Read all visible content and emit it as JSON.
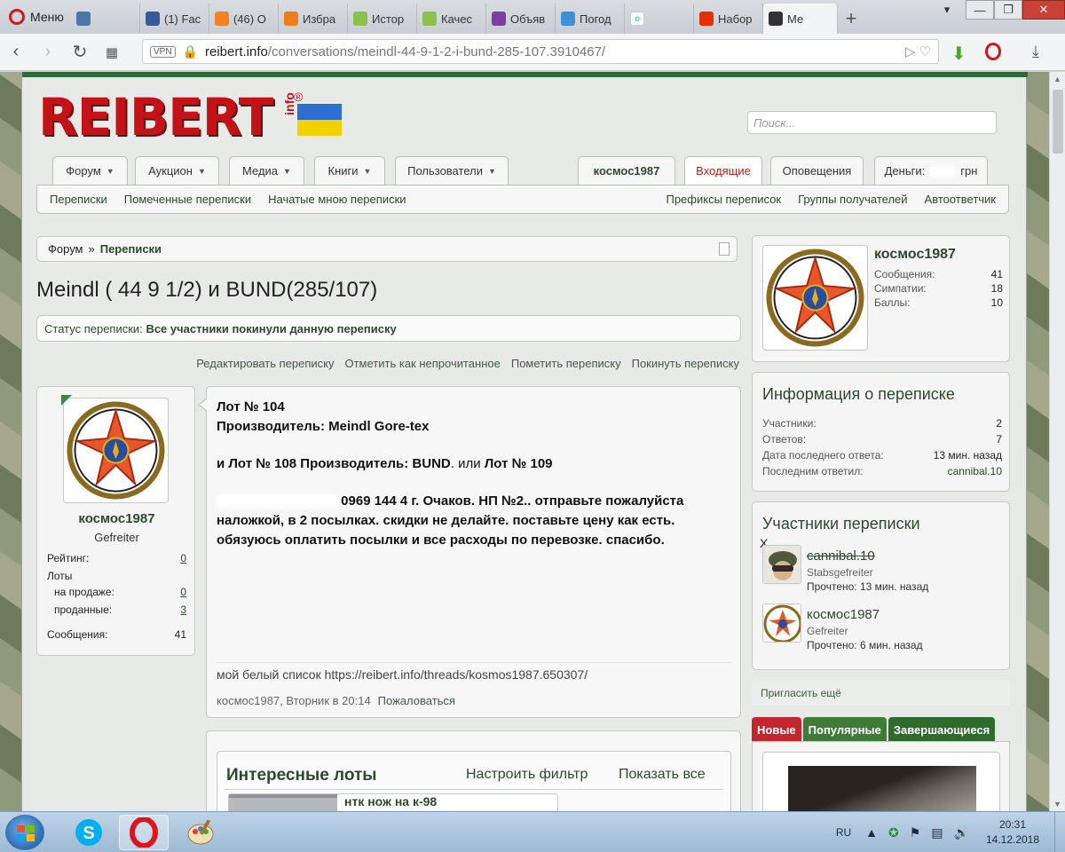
{
  "browser": {
    "menu_label": "Меню",
    "tabs": [
      {
        "label": "",
        "icon": "vk-icon",
        "color": "#4a76a8"
      },
      {
        "label": "(1) Fac",
        "icon": "facebook-icon",
        "color": "#3b5998"
      },
      {
        "label": "(46) O",
        "icon": "odnoklassniki-icon",
        "color": "#f58220"
      },
      {
        "label": "Избра",
        "icon": "orange-circle-icon",
        "color": "#f07d1a"
      },
      {
        "label": "Истор",
        "icon": "smiley-icon",
        "color": "#8bc34a"
      },
      {
        "label": "Качес",
        "icon": "smiley-icon",
        "color": "#8bc34a"
      },
      {
        "label": "Объяв",
        "icon": "globe-icon",
        "color": "#7b3fa0"
      },
      {
        "label": "Погод",
        "icon": "weather-icon",
        "color": "#3d8fd6"
      },
      {
        "label": "",
        "icon": "olx-icon",
        "color": "#ffffff"
      },
      {
        "label": "Набор",
        "icon": "aliexpress-icon",
        "color": "#e62e04"
      },
      {
        "label": "Ме",
        "icon": "cross-icon",
        "color": "#333333",
        "active": true
      }
    ],
    "url_host": "reibert.info",
    "url_path": "/conversations/meindl-44-9-1-2-i-bund-285-107.3910467/",
    "vpn_label": "VPN"
  },
  "site": {
    "logo_text": "REIBERT",
    "logo_sub": "info",
    "logo_reg": "®",
    "search_placeholder": "Поиск..."
  },
  "nav": {
    "tabs": [
      {
        "label": "Форум"
      },
      {
        "label": "Аукцион"
      },
      {
        "label": "Медиа"
      },
      {
        "label": "Книги"
      },
      {
        "label": "Пользователи"
      }
    ],
    "user_tab": "космос1987",
    "inbox_tab": "Входящие",
    "alerts_tab": "Оповещения",
    "money_label": "Деньги:",
    "money_unit": "грн",
    "sub_left": [
      "Переписки",
      "Помеченные переписки",
      "Начатые мною переписки"
    ],
    "sub_right": [
      "Префиксы переписок",
      "Группы получателей",
      "Автоответчик"
    ]
  },
  "breadcrumb": {
    "root": "Форум",
    "sep": "»",
    "current": "Переписки"
  },
  "conversation": {
    "title": "Meindl ( 44 9 1/2) и BUND(285/107)",
    "status_label": "Статус переписки:",
    "status_value": "Все участники покинули данную переписку",
    "actions": [
      "Редактировать переписку",
      "Отметить как непрочитанное",
      "Пометить переписку",
      "Покинуть переписку"
    ]
  },
  "author_card": {
    "name": "космос1987",
    "rank": "Gefreiter",
    "rating_label": "Рейтинг:",
    "rating_value": "0",
    "lots_label": "Лоты",
    "for_sale_label": "на продаже:",
    "for_sale_value": "0",
    "sold_label": "проданные:",
    "sold_value": "3",
    "messages_label": "Сообщения:",
    "messages_value": "41"
  },
  "message": {
    "line1": "Лот № 104",
    "line2": "Производитель: Meindl Gore-tex",
    "line3_a": "и Лот № 108 Производитель: BUND",
    "line3_b": ". или ",
    "line3_c": "Лот № 109",
    "line4": " 0969  144  4 г. Очаков. НП №2.. отправьте пожалуйста наложкой, в 2 посылках. скидки не делайте. поставьте цену как есть. обязуюсь оплатить посылки и все расходы по перевозке. спасибо.",
    "signature": "мой белый список https://reibert.info/threads/kosmos1987.650307/",
    "meta": "космос1987, Вторник в 20:14",
    "report": "Пожаловаться"
  },
  "lots_widget": {
    "title": "Интересные лоты",
    "filter": "Настроить фильтр",
    "show_all": "Показать все",
    "first_item": "нтк нож на к-98"
  },
  "profile": {
    "name": "космос1987",
    "stats": [
      {
        "label": "Сообщения:",
        "value": "41"
      },
      {
        "label": "Симпатии:",
        "value": "18"
      },
      {
        "label": "Баллы:",
        "value": "10"
      }
    ]
  },
  "info": {
    "title": "Информация о переписке",
    "rows": [
      {
        "label": "Участники:",
        "value": "2"
      },
      {
        "label": "Ответов:",
        "value": "7"
      },
      {
        "label": "Дата последнего ответа:",
        "value": "13 мин. назад"
      },
      {
        "label": "Последним ответил:",
        "value": "cannibal.10"
      }
    ]
  },
  "participants": {
    "title": "Участники переписки",
    "list": [
      {
        "name": "cannibal.10",
        "rank": "Stabsgefreiter",
        "read": "Прочтено: 13 мин. назад",
        "left": true
      },
      {
        "name": "космос1987",
        "rank": "Gefreiter",
        "read": "Прочтено: 6 мин. назад",
        "left": false
      }
    ],
    "left_mark": "X"
  },
  "invite": "Пригласить ещё",
  "auction_tabs": [
    "Новые",
    "Популярные",
    "Завершающиеся"
  ],
  "taskbar": {
    "lang": "RU",
    "time": "20:31",
    "date": "14.12.2018"
  },
  "colors": {
    "brand_red": "#c41219",
    "link_green": "#2b4a2b",
    "top_green": "#2d6b37"
  }
}
